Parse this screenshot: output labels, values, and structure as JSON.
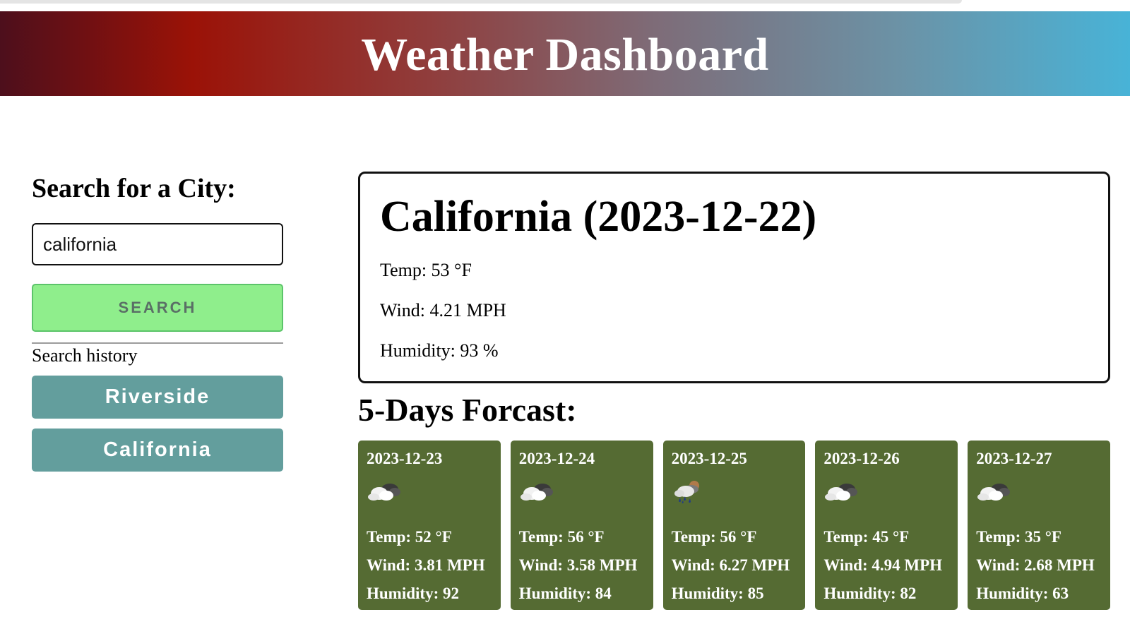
{
  "header": {
    "title": "Weather Dashboard"
  },
  "sidebar": {
    "heading": "Search for a City:",
    "search_value": "california",
    "search_button": "SEARCH",
    "history_label": "Search history",
    "history": [
      "Riverside",
      "California"
    ]
  },
  "current": {
    "title": "California (2023-12-22)",
    "temp": "Temp: 53 °F",
    "wind": "Wind: 4.21 MPH",
    "humidity": "Humidity: 93 %"
  },
  "forecast": {
    "title": "5-Days Forcast:",
    "days": [
      {
        "date": "2023-12-23",
        "icon": "cloud-overcast-icon",
        "temp": "Temp: 52 °F",
        "wind": "Wind: 3.81 MPH",
        "humidity": "Humidity: 92"
      },
      {
        "date": "2023-12-24",
        "icon": "cloud-overcast-icon",
        "temp": "Temp: 56 °F",
        "wind": "Wind: 3.58 MPH",
        "humidity": "Humidity: 84"
      },
      {
        "date": "2023-12-25",
        "icon": "rain-icon",
        "temp": "Temp: 56 °F",
        "wind": "Wind: 6.27 MPH",
        "humidity": "Humidity: 85"
      },
      {
        "date": "2023-12-26",
        "icon": "cloud-overcast-icon",
        "temp": "Temp: 45 °F",
        "wind": "Wind: 4.94 MPH",
        "humidity": "Humidity: 82"
      },
      {
        "date": "2023-12-27",
        "icon": "cloud-overcast-icon",
        "temp": "Temp: 35 °F",
        "wind": "Wind: 2.68 MPH",
        "humidity": "Humidity: 63"
      }
    ]
  },
  "colors": {
    "search_button": "#8fee8c",
    "history_button": "#639e9d",
    "forecast_card": "#556b33"
  }
}
